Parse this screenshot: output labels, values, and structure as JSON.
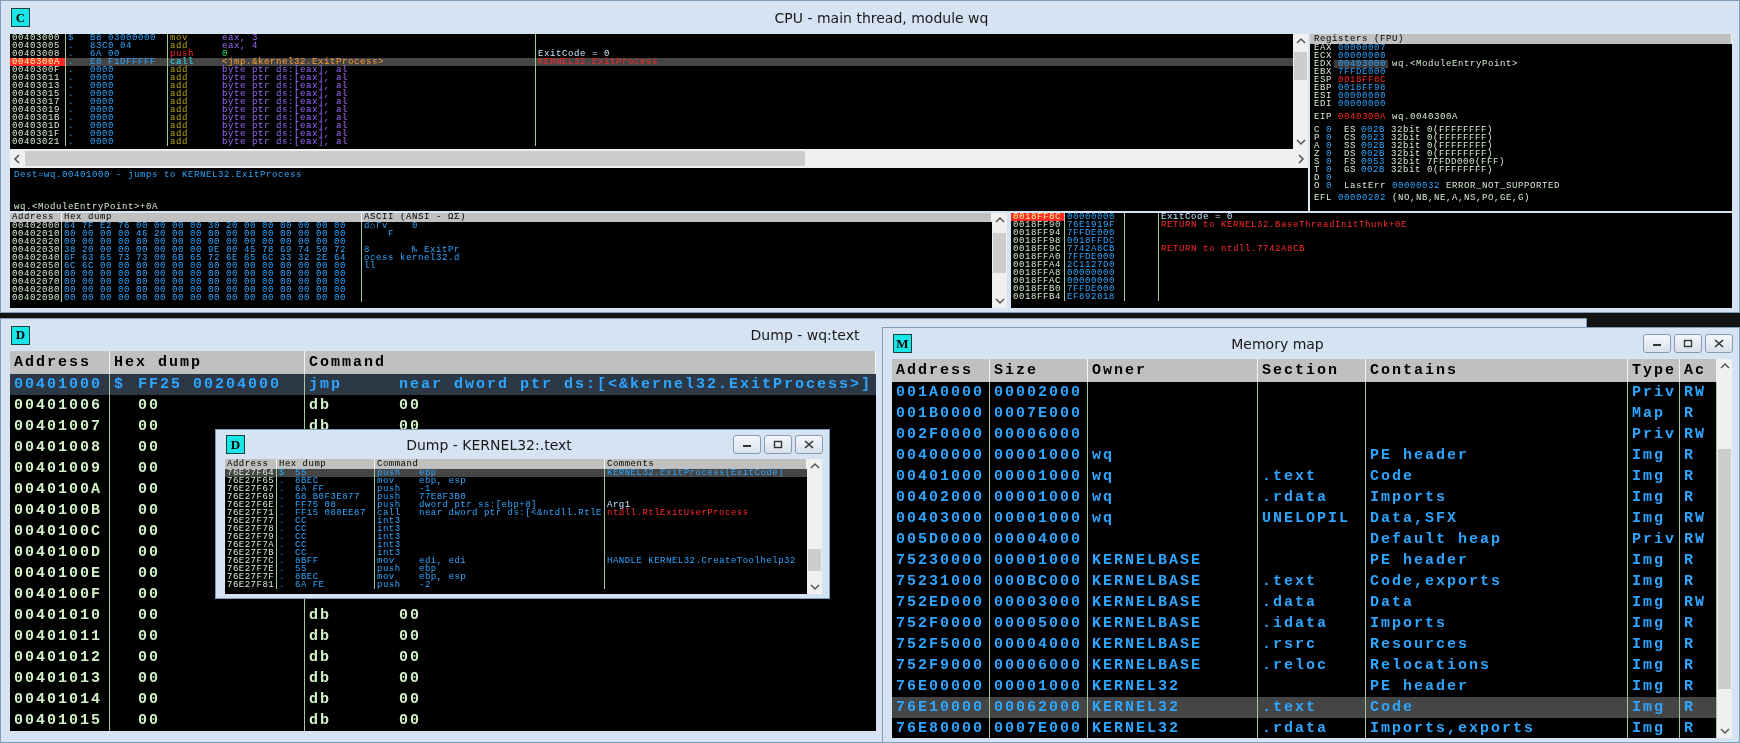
{
  "cpu_window": {
    "icon_letter": "C",
    "title": "CPU - main thread, module wq",
    "disassembly": {
      "rows": [
        {
          "address": "00403000",
          "mark": "$",
          "hex": "B8 03000000",
          "mnemonic": "mov",
          "operands": "eax, 3",
          "kind": "move",
          "selected": false
        },
        {
          "address": "00403005",
          "mark": ".",
          "hex": "83C0 04",
          "mnemonic": "add",
          "operands": "eax, 4",
          "kind": "arith",
          "selected": false
        },
        {
          "address": "00403008",
          "mark": ".",
          "hex": "6A 00",
          "mnemonic": "push",
          "operands": "0",
          "kind": "stack",
          "comment": {
            "text": "ExitCode = 0",
            "kind": "arg"
          },
          "selected": false
        },
        {
          "address": "0040300A",
          "mark": ".",
          "hex": "E8 F1DFFFFF",
          "mnemonic": "call",
          "operands": "<jmp.&kernel32.ExitProcess>",
          "kind": "call",
          "comment": {
            "text": "KERNEL32.ExitProcess",
            "kind": "call"
          },
          "selected": true
        },
        {
          "address": "0040300F",
          "mark": ".",
          "hex": "0000",
          "mnemonic": "add",
          "operands": "byte ptr ds:[eax], al",
          "kind": "arith",
          "selected": false
        },
        {
          "address": "00403011",
          "mark": ".",
          "hex": "0000",
          "mnemonic": "add",
          "operands": "byte ptr ds:[eax], al",
          "kind": "arith",
          "selected": false
        },
        {
          "address": "00403013",
          "mark": ".",
          "hex": "0000",
          "mnemonic": "add",
          "operands": "byte ptr ds:[eax], al",
          "kind": "arith",
          "selected": false
        },
        {
          "address": "00403015",
          "mark": ".",
          "hex": "0000",
          "mnemonic": "add",
          "operands": "byte ptr ds:[eax], al",
          "kind": "arith",
          "selected": false
        },
        {
          "address": "00403017",
          "mark": ".",
          "hex": "0000",
          "mnemonic": "add",
          "operands": "byte ptr ds:[eax], al",
          "kind": "arith",
          "selected": false
        },
        {
          "address": "00403019",
          "mark": ".",
          "hex": "0000",
          "mnemonic": "add",
          "operands": "byte ptr ds:[eax], al",
          "kind": "arith",
          "selected": false
        },
        {
          "address": "0040301B",
          "mark": ".",
          "hex": "0000",
          "mnemonic": "add",
          "operands": "byte ptr ds:[eax], al",
          "kind": "arith",
          "selected": false
        },
        {
          "address": "0040301D",
          "mark": ".",
          "hex": "0000",
          "mnemonic": "add",
          "operands": "byte ptr ds:[eax], al",
          "kind": "arith",
          "selected": false
        },
        {
          "address": "0040301F",
          "mark": ".",
          "hex": "0000",
          "mnemonic": "add",
          "operands": "byte ptr ds:[eax], al",
          "kind": "arith",
          "selected": false
        },
        {
          "address": "00403021",
          "mark": ".",
          "hex": "0000",
          "mnemonic": "add",
          "operands": "byte ptr ds:[eax], al",
          "kind": "arith",
          "selected": false
        }
      ]
    },
    "info_lines": [
      "Dest=wq.00401000 - jumps to KERNEL32.ExitProcess",
      "wq.<ModuleEntryPoint>+0A"
    ],
    "registers": {
      "title": "Registers (FPU)",
      "general": [
        {
          "name": "EAX",
          "value": "00000007",
          "changed": false,
          "selected": false
        },
        {
          "name": "ECX",
          "value": "00000000",
          "changed": false,
          "selected": false
        },
        {
          "name": "EDX",
          "value": "00403000",
          "comment": "wq.<ModuleEntryPoint>",
          "changed": false,
          "selected": true
        },
        {
          "name": "EBX",
          "value": "7FFDE000",
          "changed": false,
          "selected": false
        },
        {
          "name": "ESP",
          "value": "0018FF8C",
          "changed": true,
          "selected": false
        },
        {
          "name": "EBP",
          "value": "0018FF98",
          "changed": false,
          "selected": false
        },
        {
          "name": "ESI",
          "value": "00000000",
          "changed": false,
          "selected": false
        },
        {
          "name": "EDI",
          "value": "00000000",
          "changed": false,
          "selected": false
        }
      ],
      "eip": {
        "name": "EIP",
        "value": "0040300A",
        "comment": "wq.0040300A",
        "changed": true
      },
      "flags": [
        {
          "flag": "C",
          "bit": "0",
          "segment": "ES",
          "selector": "002B",
          "info": "32bit 0(FFFFFFFF)"
        },
        {
          "flag": "P",
          "bit": "0",
          "segment": "CS",
          "selector": "0023",
          "info": "32bit 0(FFFFFFFF)"
        },
        {
          "flag": "A",
          "bit": "0",
          "segment": "SS",
          "selector": "002B",
          "info": "32bit 0(FFFFFFFF)"
        },
        {
          "flag": "Z",
          "bit": "0",
          "segment": "DS",
          "selector": "002B",
          "info": "32bit 0(FFFFFFFF)"
        },
        {
          "flag": "S",
          "bit": "0",
          "segment": "FS",
          "selector": "0053",
          "info": "32bit 7FFDD000(FFF)"
        },
        {
          "flag": "T",
          "bit": "0",
          "segment": "GS",
          "selector": "002B",
          "info": "32bit 0(FFFFFFFF)"
        },
        {
          "flag": "D",
          "bit": "0"
        },
        {
          "flag": "O",
          "bit": "0",
          "segment": "LastErr",
          "selector": "00000032",
          "info": "ERROR_NOT_SUPPORTED"
        }
      ],
      "efl": {
        "name": "EFL",
        "value": "00000202",
        "info": "(NO,NB,NE,A,NS,PO,GE,G)"
      }
    },
    "dump": {
      "columns": [
        "Address",
        "Hex dump",
        "ASCII (ANSI - ΩΣ)"
      ],
      "rows": [
        {
          "address": "00402000",
          "hex": "64 7F E2 76 00 00 00 00 30 20 00 00 00 00 00 00",
          "ascii": "d⌂Γv    0"
        },
        {
          "address": "00402010",
          "hex": "00 00 00 00 46 20 00 00 00 00 00 00 00 00 00 00",
          "ascii": "    F"
        },
        {
          "address": "00402020",
          "hex": "00 00 00 00 00 00 00 00 00 00 00 00 00 00 00 00"
        },
        {
          "address": "00402030",
          "hex": "38 20 00 00 00 00 00 00 9E 00 45 78 69 74 50 72",
          "ascii": "8       ₧ ExitPr"
        },
        {
          "address": "00402040",
          "hex": "6F 63 65 73 73 00 6B 65 72 6E 65 6C 33 32 2E 64",
          "ascii": "ocess kernel32.d"
        },
        {
          "address": "00402050",
          "hex": "6C 6C 00 00 00 00 00 00 00 00 00 00 00 00 00 00",
          "ascii": "ll"
        },
        {
          "address": "00402060",
          "hex": "00 00 00 00 00 00 00 00 00 00 00 00 00 00 00 00"
        },
        {
          "address": "00402070",
          "hex": "00 00 00 00 00 00 00 00 00 00 00 00 00 00 00 00"
        },
        {
          "address": "00402080",
          "hex": "00 00 00 00 00 00 00 00 00 00 00 00 00 00 00 00"
        },
        {
          "address": "00402090",
          "hex": "00 00 00 00 00 00 00 00 00 00 00 00 00 00 00 00"
        }
      ]
    },
    "stack": {
      "rows": [
        {
          "address": "0018FF8C",
          "value": "00000000",
          "comment": {
            "text": "ExitCode = 0",
            "kind": "arg"
          },
          "selected": true
        },
        {
          "address": "0018FF90",
          "value": "76E1919F",
          "comment": {
            "text": "RETURN to KERNEL32.BaseThreadInitThunk+0E",
            "kind": "return"
          },
          "selected": false
        },
        {
          "address": "0018FF94",
          "value": "7FFDE000",
          "selected": false
        },
        {
          "address": "0018FF98",
          "value": "0018FFDC",
          "selected": false
        },
        {
          "address": "0018FF9C",
          "value": "7742A8CB",
          "comment": {
            "text": "RETURN to ntdll.7742A8CB",
            "kind": "return"
          },
          "selected": false
        },
        {
          "address": "0018FFA0",
          "value": "7FFDE000",
          "selected": false
        },
        {
          "address": "0018FFA4",
          "value": "2C1127D0",
          "selected": false
        },
        {
          "address": "0018FFA8",
          "value": "00000000",
          "selected": false
        },
        {
          "address": "0018FFAC",
          "value": "00000000",
          "selected": false
        },
        {
          "address": "0018FFB0",
          "value": "7FFDE000",
          "selected": false
        },
        {
          "address": "0018FFB4",
          "value": "EF892818",
          "selected": false
        }
      ]
    }
  },
  "dump_window": {
    "icon_letter": "D",
    "title": "Dump - wq:text",
    "columns": [
      "Address",
      "Hex dump",
      "Command"
    ],
    "rows": [
      {
        "address": "00401000",
        "mark": "$",
        "hex": "FF25 00204000",
        "mnemonic": "jmp",
        "operands": "near dword ptr ds:[<&kernel32.ExitProcess>]",
        "kind": "code",
        "selected": true
      },
      {
        "address": "00401006",
        "hex": "00",
        "mnemonic": "db",
        "operands": "00",
        "kind": "data",
        "selected": false
      },
      {
        "address": "00401007",
        "hex": "00",
        "mnemonic": "db",
        "operands": "00",
        "kind": "data",
        "selected": false
      },
      {
        "address": "00401008",
        "hex": "00",
        "kind": "data",
        "selected": false
      },
      {
        "address": "00401009",
        "hex": "00",
        "kind": "data",
        "selected": false
      },
      {
        "address": "0040100A",
        "hex": "00",
        "kind": "data",
        "selected": false
      },
      {
        "address": "0040100B",
        "hex": "00",
        "kind": "data",
        "selected": false
      },
      {
        "address": "0040100C",
        "hex": "00",
        "kind": "data",
        "selected": false
      },
      {
        "address": "0040100D",
        "hex": "00",
        "kind": "data",
        "selected": false
      },
      {
        "address": "0040100E",
        "hex": "00",
        "kind": "data",
        "selected": false
      },
      {
        "address": "0040100F",
        "hex": "00",
        "kind": "data",
        "selected": false
      },
      {
        "address": "00401010",
        "hex": "00",
        "mnemonic": "db",
        "operands": "00",
        "kind": "data",
        "selected": false
      },
      {
        "address": "00401011",
        "hex": "00",
        "mnemonic": "db",
        "operands": "00",
        "kind": "data",
        "selected": false
      },
      {
        "address": "00401012",
        "hex": "00",
        "mnemonic": "db",
        "operands": "00",
        "kind": "data",
        "selected": false
      },
      {
        "address": "00401013",
        "hex": "00",
        "mnemonic": "db",
        "operands": "00",
        "kind": "data",
        "selected": false
      },
      {
        "address": "00401014",
        "hex": "00",
        "mnemonic": "db",
        "operands": "00",
        "kind": "data",
        "selected": false
      },
      {
        "address": "00401015",
        "hex": "00",
        "mnemonic": "db",
        "operands": "00",
        "kind": "data",
        "selected": false
      }
    ]
  },
  "kernel_dump_window": {
    "icon_letter": "D",
    "title": "Dump - KERNEL32:.text",
    "columns": [
      "Address",
      "Hex dump",
      "Command",
      "Comments"
    ],
    "rows": [
      {
        "address": "76E27F64",
        "mark": "$",
        "hex": "55",
        "mnemonic": "push",
        "operands": "ebp",
        "comment": {
          "text": "KERNEL32.ExitProcess(ExitCode)",
          "kind": "info"
        },
        "selected": true
      },
      {
        "address": "76E27F65",
        "mark": ".",
        "hex": "8BEC",
        "mnemonic": "mov",
        "operands": "ebp, esp",
        "selected": false
      },
      {
        "address": "76E27F67",
        "mark": ".",
        "hex": "6A FF",
        "mnemonic": "push",
        "operands": "-1",
        "selected": false
      },
      {
        "address": "76E27F69",
        "mark": ".",
        "hex": "68 B0F3E877",
        "mnemonic": "push",
        "operands": "77E8F3B0",
        "selected": false
      },
      {
        "address": "76E27F6E",
        "mark": ".",
        "hex": "FF75 08",
        "mnemonic": "push",
        "operands": "dword ptr ss:[ebp+8]",
        "comment": {
          "text": "Arg1",
          "kind": "arg"
        },
        "selected": false
      },
      {
        "address": "76E27F71",
        "mark": ".",
        "hex": "FF15 080EE87",
        "mnemonic": "call",
        "operands": "near dword ptr ds:[<&ntdll.RtlE",
        "comment": {
          "text": "ntdll.RtlExitUserProcess",
          "kind": "call"
        },
        "selected": false
      },
      {
        "address": "76E27F77",
        "mark": ".",
        "hex": "CC",
        "mnemonic": "int3",
        "selected": false
      },
      {
        "address": "76E27F78",
        "mark": ".",
        "hex": "CC",
        "mnemonic": "int3",
        "selected": false
      },
      {
        "address": "76E27F79",
        "mark": ".",
        "hex": "CC",
        "mnemonic": "int3",
        "selected": false
      },
      {
        "address": "76E27F7A",
        "mark": ".",
        "hex": "CC",
        "mnemonic": "int3",
        "selected": false
      },
      {
        "address": "76E27F7B",
        "mark": ".",
        "hex": "CC",
        "mnemonic": "int3",
        "selected": false
      },
      {
        "address": "76E27F7C",
        "mark": ".",
        "hex": "8BFF",
        "mnemonic": "mov",
        "operands": "edi, edi",
        "comment": {
          "text": "HANDLE KERNEL32.CreateToolhelp32",
          "kind": "info"
        },
        "selected": false
      },
      {
        "address": "76E27F7E",
        "mark": ".",
        "hex": "55",
        "mnemonic": "push",
        "operands": "ebp",
        "selected": false
      },
      {
        "address": "76E27F7F",
        "mark": ".",
        "hex": "8BEC",
        "mnemonic": "mov",
        "operands": "ebp, esp",
        "selected": false
      },
      {
        "address": "76E27F81",
        "mark": ".",
        "hex": "6A FE",
        "mnemonic": "push",
        "operands": "-2",
        "selected": false
      }
    ]
  },
  "memory_map_window": {
    "icon_letter": "M",
    "title": "Memory map",
    "columns": [
      "Address",
      "Size",
      "Owner",
      "Section",
      "Contains",
      "Type",
      "Ac"
    ],
    "rows": [
      {
        "address": "001A0000",
        "size": "00002000",
        "type": "Priv",
        "access": "RW",
        "selected": false
      },
      {
        "address": "001B0000",
        "size": "0007E000",
        "type": "Map",
        "access": "R",
        "selected": false
      },
      {
        "address": "002F0000",
        "size": "00006000",
        "type": "Priv",
        "access": "RW",
        "selected": false
      },
      {
        "address": "00400000",
        "size": "00001000",
        "owner": "wq",
        "contains": "PE header",
        "type": "Img",
        "access": "R",
        "selected": false
      },
      {
        "address": "00401000",
        "size": "00001000",
        "owner": "wq",
        "section": ".text",
        "contains": "Code",
        "type": "Img",
        "access": "R",
        "selected": false
      },
      {
        "address": "00402000",
        "size": "00001000",
        "owner": "wq",
        "section": ".rdata",
        "contains": "Imports",
        "type": "Img",
        "access": "R",
        "selected": false
      },
      {
        "address": "00403000",
        "size": "00001000",
        "owner": "wq",
        "section": "UNELOPIL",
        "contains": "Data,SFX",
        "type": "Img",
        "access": "RW",
        "selected": false
      },
      {
        "address": "005D0000",
        "size": "00004000",
        "contains": "Default heap",
        "type": "Priv",
        "access": "RW",
        "selected": false
      },
      {
        "address": "75230000",
        "size": "00001000",
        "owner": "KERNELBASE",
        "contains": "PE header",
        "type": "Img",
        "access": "R",
        "selected": false
      },
      {
        "address": "75231000",
        "size": "000BC000",
        "owner": "KERNELBASE",
        "section": ".text",
        "contains": "Code,exports",
        "type": "Img",
        "access": "R",
        "selected": false
      },
      {
        "address": "752ED000",
        "size": "00003000",
        "owner": "KERNELBASE",
        "section": ".data",
        "contains": "Data",
        "type": "Img",
        "access": "RW",
        "selected": false
      },
      {
        "address": "752F0000",
        "size": "00005000",
        "owner": "KERNELBASE",
        "section": ".idata",
        "contains": "Imports",
        "type": "Img",
        "access": "R",
        "selected": false
      },
      {
        "address": "752F5000",
        "size": "00004000",
        "owner": "KERNELBASE",
        "section": ".rsrc",
        "contains": "Resources",
        "type": "Img",
        "access": "R",
        "selected": false
      },
      {
        "address": "752F9000",
        "size": "00006000",
        "owner": "KERNELBASE",
        "section": ".reloc",
        "contains": "Relocations",
        "type": "Img",
        "access": "R",
        "selected": false
      },
      {
        "address": "76E00000",
        "size": "00001000",
        "owner": "KERNEL32",
        "contains": "PE header",
        "type": "Img",
        "access": "R",
        "selected": false
      },
      {
        "address": "76E10000",
        "size": "00062000",
        "owner": "KERNEL32",
        "section": ".text",
        "contains": "Code",
        "type": "Img",
        "access": "R",
        "selected": true
      },
      {
        "address": "76E80000",
        "size": "0007E000",
        "owner": "KERNEL32",
        "section": ".rdata",
        "contains": "Imports,exports",
        "type": "Img",
        "access": "R",
        "selected": false
      }
    ]
  }
}
